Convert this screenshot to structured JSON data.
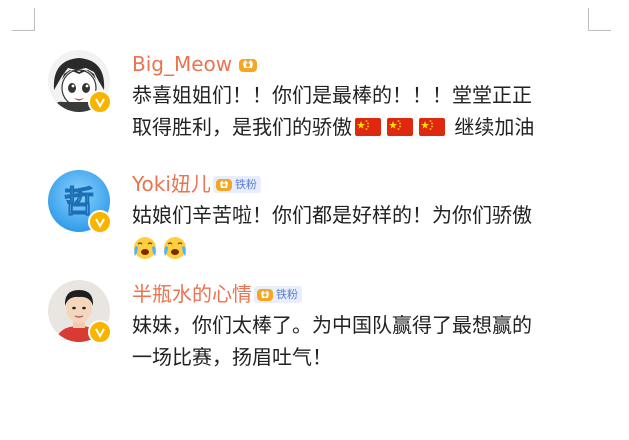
{
  "comments": [
    {
      "username": "Big_Meow",
      "avatar_icon": "anime-girl-avatar",
      "badge_icon": "crown-icon",
      "line1": "恭喜姐姐们！！你们是最棒的！！！堂堂正正",
      "line2_text": "取得胜利，是我们的骄傲",
      "line2_end": "继续加油",
      "flag_icon": "china-flag-icon",
      "flag_count": 3
    },
    {
      "username": "Yoki妞儿",
      "avatar_icon": "zhe-character-avatar",
      "avatar_char": "哲",
      "badge_icon": "crown-icon",
      "fan_label": "铁粉",
      "line1": "姑娘们辛苦啦！你们都是好样的！为你们骄傲",
      "emoji_icon": "crying-face-emoji",
      "emoji_count": 2
    },
    {
      "username": "半瓶水的心情",
      "avatar_icon": "young-man-avatar",
      "badge_icon": "crown-icon",
      "fan_label": "铁粉",
      "line1": "妹妹，你们太棒了。为中国队赢得了最想赢的",
      "line2": "一场比赛，扬眉吐气！"
    }
  ],
  "colors": {
    "username": "#eb7350",
    "text": "#222222",
    "verified_badge": "#f7b500",
    "fan_tag_bg": "#e9eefc",
    "fan_tag_text": "#5b7bd5"
  }
}
